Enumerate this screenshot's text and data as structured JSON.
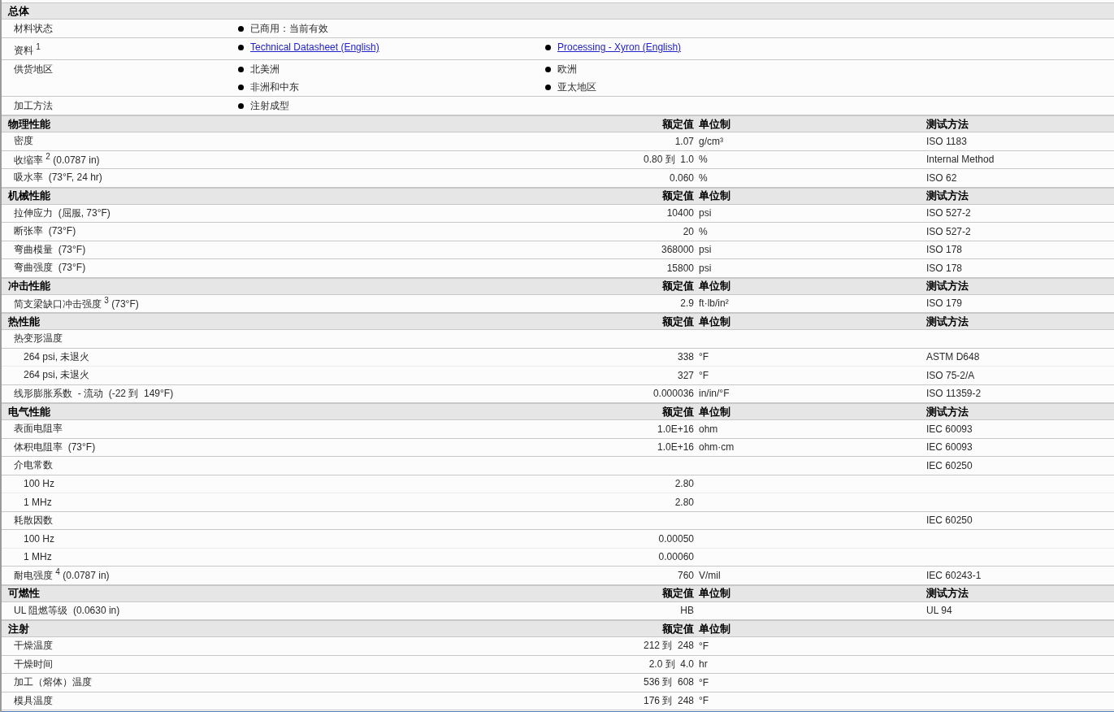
{
  "general": {
    "title": "总体",
    "rows": [
      {
        "label": "材料状态",
        "items": [
          {
            "kind": "text",
            "text": "已商用：当前有效"
          }
        ]
      },
      {
        "label": "资料 $^{1}$",
        "items": [
          {
            "kind": "link",
            "text": "Technical Datasheet (English)"
          },
          {
            "kind": "link",
            "text": "Processing - Xyron (English)"
          }
        ]
      },
      {
        "label": "供货地区",
        "items": [
          {
            "kind": "text",
            "text": "北美洲"
          },
          {
            "kind": "text",
            "text": "欧洲"
          },
          {
            "kind": "text",
            "text": "非洲和中东"
          },
          {
            "kind": "text",
            "text": "亚太地区"
          }
        ]
      },
      {
        "label": "加工方法",
        "items": [
          {
            "kind": "text",
            "text": "注射成型"
          }
        ]
      }
    ]
  },
  "sections": [
    {
      "title": "物理性能",
      "headers": {
        "value": "额定值",
        "unit": "单位制",
        "method": "测试方法"
      },
      "rows": [
        {
          "label": "密度",
          "value": "1.07",
          "unit": "g/cm³",
          "method": "ISO 1183"
        },
        {
          "label": "收缩率 $^{2}$ (0.0787 in)",
          "value": "0.80 到  1.0",
          "unit": "%",
          "method": "Internal Method"
        },
        {
          "label": "吸水率  (73°F, 24 hr)",
          "value": "0.060",
          "unit": "%",
          "method": "ISO 62"
        }
      ]
    },
    {
      "title": "机械性能",
      "headers": {
        "value": "额定值",
        "unit": "单位制",
        "method": "测试方法"
      },
      "rows": [
        {
          "label": "拉伸应力  (屈服, 73°F)",
          "value": "10400",
          "unit": "psi",
          "method": "ISO 527-2"
        },
        {
          "label": "断张率  (73°F)",
          "value": "20",
          "unit": "%",
          "method": "ISO 527-2"
        },
        {
          "label": "弯曲模量  (73°F)",
          "value": "368000",
          "unit": "psi",
          "method": "ISO 178"
        },
        {
          "label": "弯曲强度  (73°F)",
          "value": "15800",
          "unit": "psi",
          "method": "ISO 178"
        }
      ]
    },
    {
      "title": "冲击性能",
      "headers": {
        "value": "额定值",
        "unit": "单位制",
        "method": "测试方法"
      },
      "rows": [
        {
          "label": "简支梁缺口冲击强度 $^{3}$ (73°F)",
          "value": "2.9",
          "unit": "ft·lb/in²",
          "method": "ISO 179"
        }
      ]
    },
    {
      "title": "热性能",
      "headers": {
        "value": "额定值",
        "unit": "单位制",
        "method": "测试方法"
      },
      "rows": [
        {
          "label": "热变形温度",
          "children": [
            {
              "label": "264 psi, 未退火",
              "value": "338",
              "unit": "°F",
              "method": "ASTM D648"
            },
            {
              "label": "264 psi, 未退火",
              "value": "327",
              "unit": "°F",
              "method": "ISO 75-2/A"
            }
          ]
        },
        {
          "label": "线形膨胀系数  - 流动  (-22 到  149°F)",
          "value": "0.000036",
          "unit": "in/in/°F",
          "method": "ISO 11359-2"
        }
      ]
    },
    {
      "title": "电气性能",
      "headers": {
        "value": "额定值",
        "unit": "单位制",
        "method": "测试方法"
      },
      "rows": [
        {
          "label": "表面电阻率",
          "value": "1.0E+16",
          "unit": "ohm",
          "method": "IEC 60093"
        },
        {
          "label": "体积电阻率  (73°F)",
          "value": "1.0E+16",
          "unit": "ohm·cm",
          "method": "IEC 60093"
        },
        {
          "label": "介电常数",
          "method": "IEC 60250",
          "children": [
            {
              "label": "100 Hz",
              "value": "2.80"
            },
            {
              "label": "1 MHz",
              "value": "2.80"
            }
          ]
        },
        {
          "label": "耗散因数",
          "method": "IEC 60250",
          "children": [
            {
              "label": "100 Hz",
              "value": "0.00050"
            },
            {
              "label": "1 MHz",
              "value": "0.00060"
            }
          ]
        },
        {
          "label": "耐电强度 $^{4}$ (0.0787 in)",
          "value": "760",
          "unit": "V/mil",
          "method": "IEC 60243-1"
        }
      ]
    },
    {
      "title": "可燃性",
      "headers": {
        "value": "额定值",
        "unit": "单位制",
        "method": "测试方法"
      },
      "rows": [
        {
          "label": "UL 阻燃等级  (0.0630 in)",
          "value": "HB",
          "method": "UL 94"
        }
      ]
    },
    {
      "title": "注射",
      "headers": {
        "value": "额定值",
        "unit": "单位制"
      },
      "rows": [
        {
          "label": "干燥温度",
          "value": "212 到  248",
          "unit": "°F"
        },
        {
          "label": "干燥时间",
          "value": "2.0 到  4.0",
          "unit": "hr"
        },
        {
          "label": "加工（熔体）温度",
          "value": "536 到  608",
          "unit": "°F"
        },
        {
          "label": "模具温度",
          "value": "176 到  248",
          "unit": "°F"
        }
      ]
    }
  ]
}
